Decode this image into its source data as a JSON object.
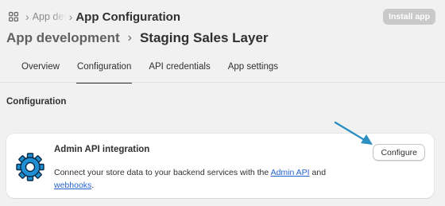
{
  "breadcrumb": {
    "apps_icon": "apps-grid-icon",
    "separator": "›",
    "parent": "App dev",
    "current": "App Configuration"
  },
  "header": {
    "install_label": "Install app",
    "title_parent": "App development",
    "title_separator": "›",
    "title_current": "Staging Sales Layer"
  },
  "tabs": [
    {
      "label": "Overview",
      "active": false
    },
    {
      "label": "Configuration",
      "active": true
    },
    {
      "label": "API credentials",
      "active": false
    },
    {
      "label": "App settings",
      "active": false
    }
  ],
  "section": {
    "title": "Configuration"
  },
  "card": {
    "icon": "gear-icon",
    "title": "Admin API integration",
    "desc_prefix": "Connect your store data to your backend services with the ",
    "link1": "Admin API",
    "desc_middle": " and",
    "link2": "webhooks",
    "desc_suffix": ".",
    "button_label": "Configure"
  },
  "annotation": {
    "arrow_color": "#2b8fc2",
    "icon": "arrow-pointer-icon"
  },
  "colors": {
    "background": "#f1f1f1",
    "link": "#2463d1",
    "gear": "#1d8fd2"
  }
}
